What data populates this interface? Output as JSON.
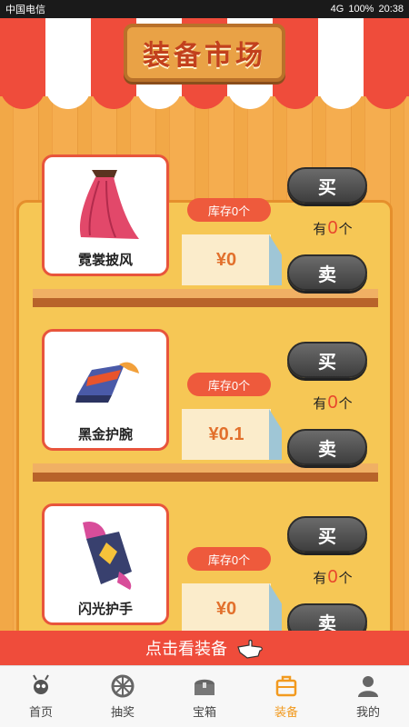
{
  "status_bar": {
    "carrier": "中国电信",
    "signal": "4G",
    "battery": "100%",
    "time": "20:38"
  },
  "header": {
    "title": "装备市场"
  },
  "labels": {
    "buy": "买",
    "sell": "卖",
    "owned_prefix": "有",
    "owned_suffix": "个"
  },
  "items": [
    {
      "name": "霓裳披风",
      "stock": "库存0个",
      "price": "¥0",
      "owned": "0"
    },
    {
      "name": "黑金护腕",
      "stock": "库存0个",
      "price": "¥0.1",
      "owned": "0"
    },
    {
      "name": "闪光护手",
      "stock": "库存0个",
      "price": "¥0",
      "owned": "0"
    }
  ],
  "cta": {
    "label": "点击看装备"
  },
  "tabs": [
    {
      "label": "首页",
      "icon": "ant-icon",
      "active": false
    },
    {
      "label": "抽奖",
      "icon": "wheel-icon",
      "active": false
    },
    {
      "label": "宝箱",
      "icon": "chest-icon",
      "active": false
    },
    {
      "label": "装备",
      "icon": "briefcase-icon",
      "active": true
    },
    {
      "label": "我的",
      "icon": "user-icon",
      "active": false
    }
  ],
  "colors": {
    "accent": "#ef4c3b",
    "active_tab": "#f29a1f",
    "panel": "#f6c755"
  }
}
